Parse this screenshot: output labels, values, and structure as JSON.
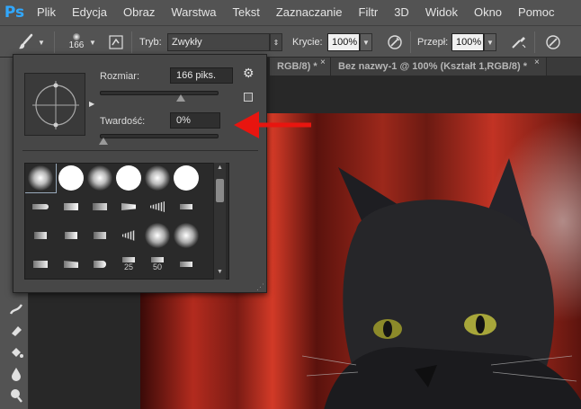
{
  "app": {
    "logo": "Ps"
  },
  "menu": [
    "Plik",
    "Edycja",
    "Obraz",
    "Warstwa",
    "Tekst",
    "Zaznaczanie",
    "Filtr",
    "3D",
    "Widok",
    "Okno",
    "Pomoc"
  ],
  "options_bar": {
    "brush_size": "166",
    "mode_label": "Tryb:",
    "mode_value": "Zwykły",
    "opacity_label": "Krycie:",
    "opacity_value": "100%",
    "flow_label": "Przepł:",
    "flow_value": "100%",
    "icons": [
      "brush-tool-icon",
      "brush-panel-toggle-icon",
      "pressure-opacity-icon",
      "airbrush-icon",
      "pressure-size-icon"
    ]
  },
  "tabs": [
    {
      "label": "RGB/8) *",
      "close": "×"
    },
    {
      "label": "Bez nazwy-1 @ 100% (Kształt 1,RGB/8) *",
      "close": "×"
    }
  ],
  "brush_panel": {
    "size_label": "Rozmiar:",
    "size_value": "166 piks.",
    "size_level": 0.68,
    "hardness_label": "Twardość:",
    "hardness_value": "0%",
    "hardness_level": 0.0,
    "preset_sizes": [
      "25",
      "50"
    ]
  },
  "colors": {
    "accent_red": "#e8150f",
    "ps_blue": "#31a8ff",
    "panel_bg": "#474747"
  }
}
